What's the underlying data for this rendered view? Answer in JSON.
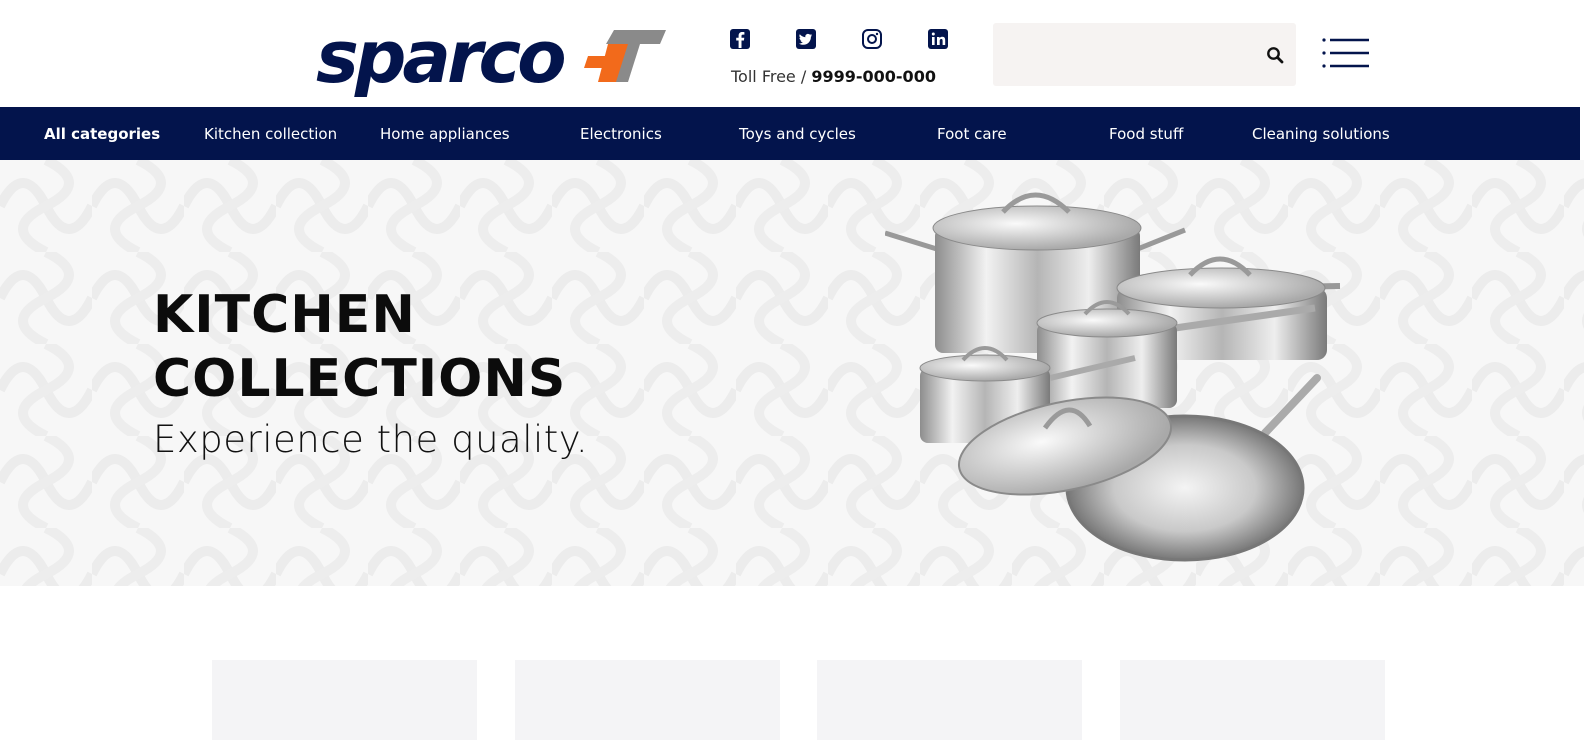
{
  "brand": {
    "logo_text": "sparco",
    "logo_mark": "T",
    "primary_color": "#03144c",
    "accent_color": "#f26a1b",
    "gray_color": "#8a8a8a"
  },
  "header": {
    "socials": [
      {
        "name": "facebook",
        "icon": "facebook-icon"
      },
      {
        "name": "twitter",
        "icon": "twitter-icon"
      },
      {
        "name": "instagram",
        "icon": "instagram-icon"
      },
      {
        "name": "linkedin",
        "icon": "linkedin-icon"
      }
    ],
    "toll_label": "Toll Free / ",
    "toll_number": "9999-000-000",
    "search": {
      "placeholder": "",
      "value": "",
      "icon": "search-icon"
    },
    "menu_icon": "hamburger-menu-icon"
  },
  "nav": {
    "items": [
      {
        "label": "All categories",
        "active": true
      },
      {
        "label": "Kitchen collection"
      },
      {
        "label": "Home appliances"
      },
      {
        "label": "Electronics"
      },
      {
        "label": "Toys and cycles"
      },
      {
        "label": "Foot care"
      },
      {
        "label": "Food stuff"
      },
      {
        "label": "Cleaning solutions"
      }
    ]
  },
  "hero": {
    "title_line1": "KITCHEN",
    "title_line2": "COLLECTIONS",
    "subtitle": "Experience the quality.",
    "image": "cookware-set-image"
  },
  "cards": [
    {
      "name": "category-card-1"
    },
    {
      "name": "category-card-2"
    },
    {
      "name": "category-card-3"
    },
    {
      "name": "category-card-4"
    }
  ]
}
